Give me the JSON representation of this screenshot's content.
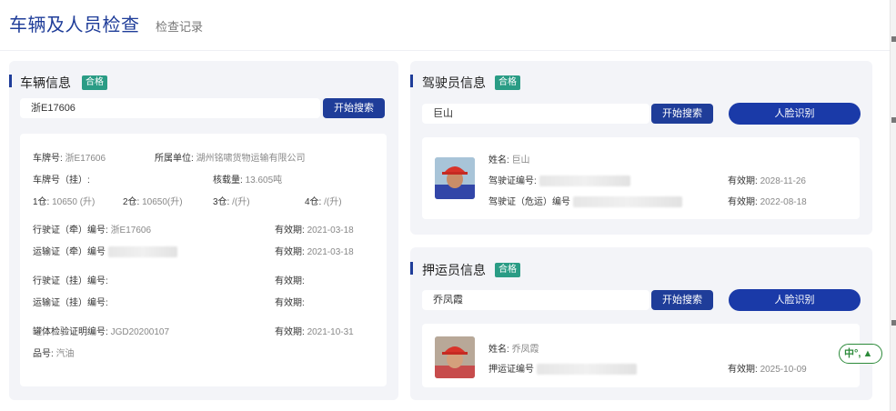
{
  "header": {
    "title": "车辆及人员检查",
    "tab_record": "检查记录"
  },
  "vehicle": {
    "title": "车辆信息",
    "status": "合格",
    "search_value": "浙E17606",
    "search_btn": "开始搜索",
    "plate_label": "车牌号:",
    "plate_value": "浙E17606",
    "unit_label": "所属单位:",
    "unit_value": "湖州铭啸货物运输有限公司",
    "trailer_plate_label": "车牌号（挂）:",
    "load_label": "核载量:",
    "load_value": "13.605吨",
    "tanks": [
      {
        "label": "1仓:",
        "value": "10650 (升)"
      },
      {
        "label": "2仓:",
        "value": "10650(升)"
      },
      {
        "label": "3仓:",
        "value": "/(升)"
      },
      {
        "label": "4仓:",
        "value": "/(升)"
      }
    ],
    "rows": [
      {
        "label": "行驶证（牵）编号:",
        "value": "浙E17606",
        "exp_label": "有效期:",
        "exp_value": "2021-03-18"
      },
      {
        "label": "运输证（牵）编号",
        "value": "",
        "exp_label": "有效期:",
        "exp_value": "2021-03-18"
      },
      {
        "label": "行驶证（挂）编号:",
        "value": "",
        "exp_label": "有效期:",
        "exp_value": ""
      },
      {
        "label": "运输证（挂）编号:",
        "value": "",
        "exp_label": "有效期:",
        "exp_value": ""
      },
      {
        "label": "罐体检验证明编号:",
        "value": "JGD20200107",
        "exp_label": "有效期:",
        "exp_value": "2021-10-31"
      }
    ],
    "product_label": "品号:",
    "product_value": "汽油"
  },
  "driver": {
    "title": "驾驶员信息",
    "status": "合格",
    "search_value": "巨山",
    "search_btn": "开始搜索",
    "face_btn": "人脸识别",
    "name_label": "姓名:",
    "name_value": "巨山",
    "license_label": "驾驶证编号:",
    "license_exp_label": "有效期:",
    "license_exp_value": "2028-11-26",
    "hazmat_label": "驾驶证（危运）编号",
    "hazmat_exp_label": "有效期:",
    "hazmat_exp_value": "2022-08-18"
  },
  "escort": {
    "title": "押运员信息",
    "status": "合格",
    "search_value": "乔凤霞",
    "search_btn": "开始搜索",
    "face_btn": "人脸识别",
    "name_label": "姓名:",
    "name_value": "乔凤霞",
    "license_label": "押运证编号",
    "exp_label": "有效期:",
    "exp_value": "2025-10-09"
  },
  "ime": {
    "label": "中°,"
  },
  "colors": {
    "primary": "#1f3d99",
    "badge": "#2a9c85",
    "panel": "#f3f4f8"
  }
}
